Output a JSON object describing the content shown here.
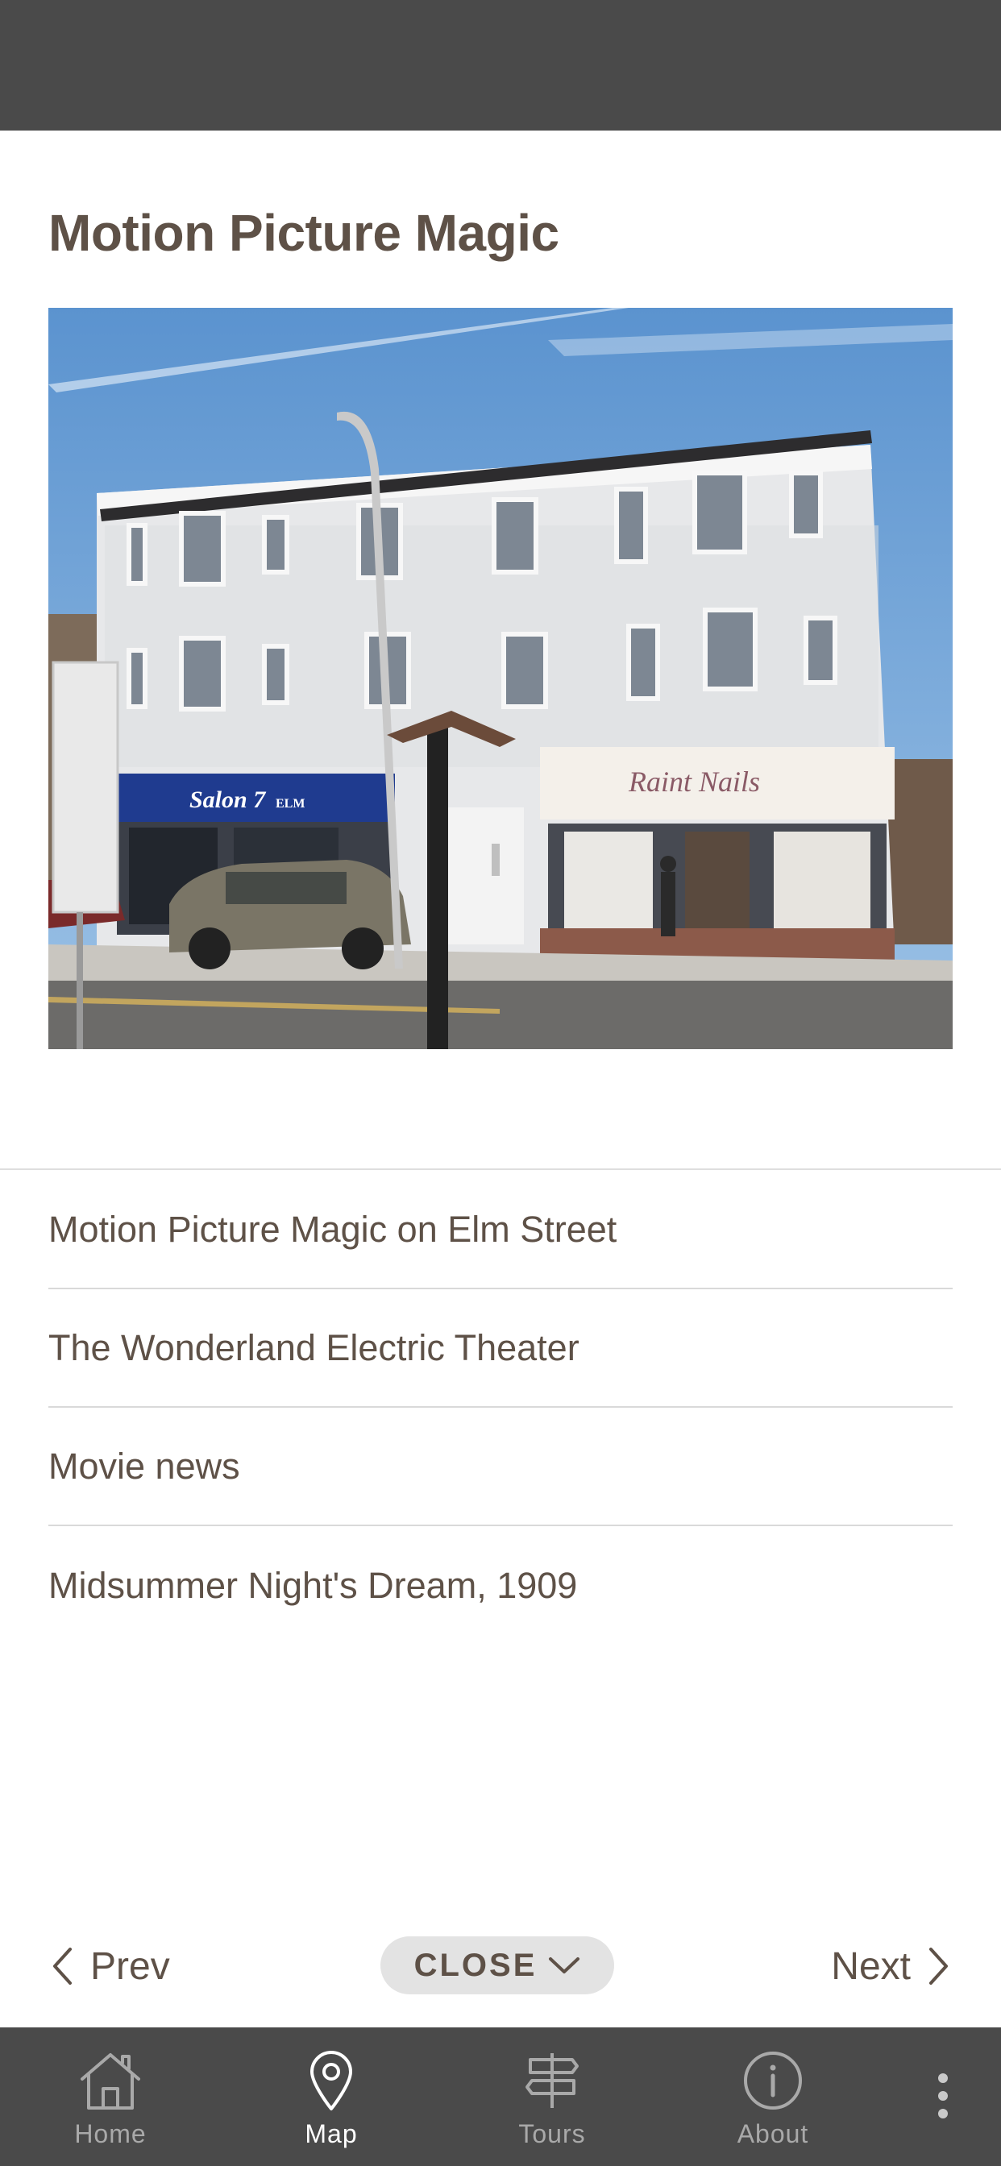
{
  "header": {
    "title": "Motion Picture Magic"
  },
  "photo": {
    "sign_left": "Salon 7",
    "sign_left_small": "ELM",
    "sign_right": "Raint Nails"
  },
  "stories": [
    {
      "label": "Motion Picture Magic on Elm Street"
    },
    {
      "label": "The Wonderland Electric Theater"
    },
    {
      "label": "Movie news"
    },
    {
      "label": "Midsummer Night's Dream, 1909"
    }
  ],
  "nav": {
    "prev": "Prev",
    "close": "CLOSE",
    "next": "Next"
  },
  "tabs": [
    {
      "label": "Home",
      "icon": "home-icon"
    },
    {
      "label": "Map",
      "icon": "map-pin-icon",
      "active": true
    },
    {
      "label": "Tours",
      "icon": "signpost-icon"
    },
    {
      "label": "About",
      "icon": "info-icon"
    }
  ],
  "colors": {
    "text": "#5e5147",
    "bar": "#4a4a4a",
    "pill": "#e3e3e3",
    "tab_inactive": "#a9a9a9",
    "tab_active": "#ffffff"
  }
}
